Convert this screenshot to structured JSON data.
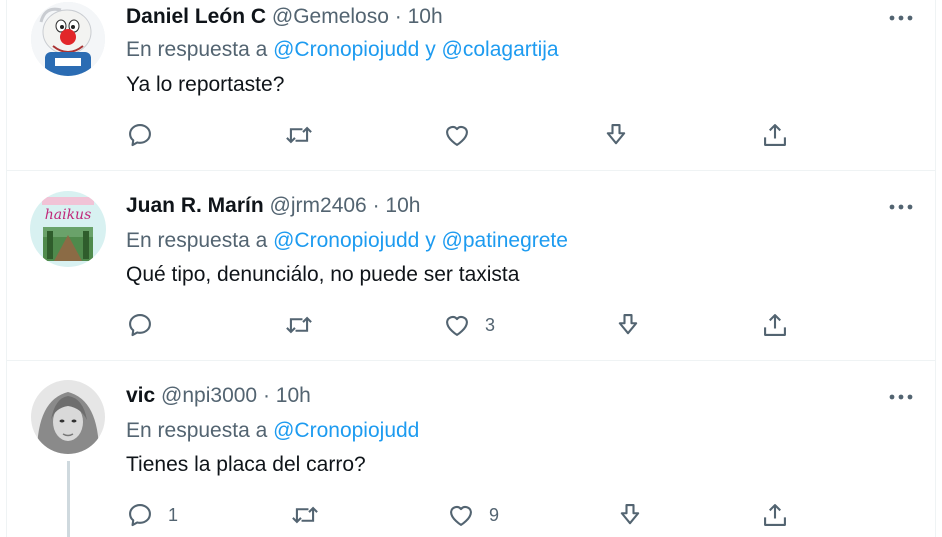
{
  "tweets": [
    {
      "name": "Daniel León C",
      "handle": "@Gemeloso",
      "dot": "·",
      "time": "10h",
      "reply_prefix": "En respuesta a",
      "mention1": "@Cronopiojudd",
      "conj": "y",
      "mention2": "@colagartija",
      "text": "Ya lo reportaste?",
      "reply_count": "",
      "retweet_count": "",
      "like_count": ""
    },
    {
      "name": "Juan R. Marín",
      "handle": "@jrm2406",
      "dot": "·",
      "time": "10h",
      "reply_prefix": "En respuesta a",
      "mention1": "@Cronopiojudd",
      "conj": "y",
      "mention2": "@patinegrete",
      "text": "Qué tipo, denunciálo, no puede ser taxista",
      "avatar_text": "haikus",
      "reply_count": "",
      "retweet_count": "",
      "like_count": "3"
    },
    {
      "name": "vic",
      "handle": "@npi3000",
      "dot": "·",
      "time": "10h",
      "reply_prefix": "En respuesta a",
      "mention1": "@Cronopiojudd",
      "text": "Tienes la placa del carro?",
      "reply_count": "1",
      "retweet_count": "",
      "like_count": "9"
    }
  ],
  "icons": {
    "reply": "reply-icon",
    "retweet": "retweet-icon",
    "like": "like-icon",
    "download": "download-icon",
    "share": "share-icon",
    "more": "more-icon"
  },
  "colors": {
    "link": "#1d9bf0",
    "secondary": "#536471",
    "text": "#0f1419",
    "divider": "#eff3f4"
  }
}
